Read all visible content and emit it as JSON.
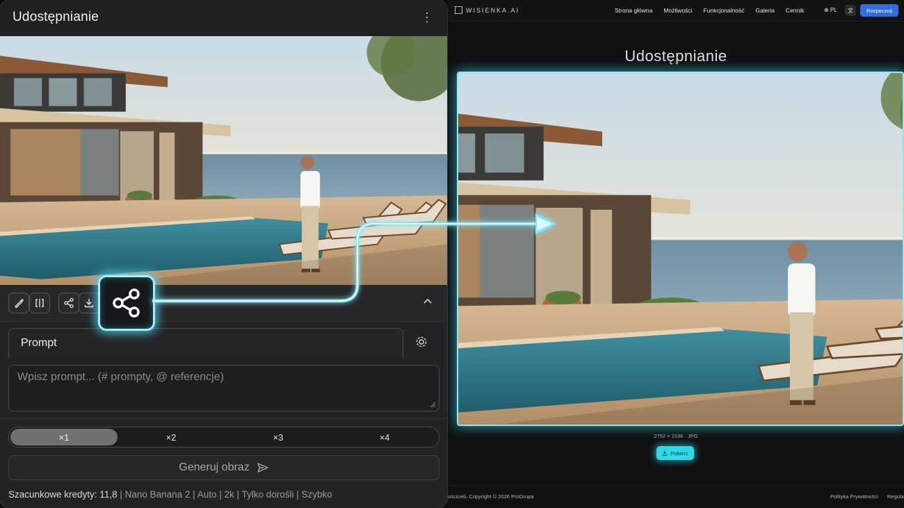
{
  "left": {
    "title": "Udostępnianie",
    "menu_icon": "kebab-vertical-icon",
    "toolbar_icons": [
      "brush-icon",
      "compare-icon",
      "share-icon",
      "download-icon",
      "chevron-up-icon"
    ],
    "highlight_icon": "share-icon",
    "prompt_tab": "Prompt",
    "prompt_placeholder": "Wpisz prompt... (# prompty, @ referencje)",
    "multipliers": [
      "×1",
      "×2",
      "×3",
      "×4"
    ],
    "selected_multiplier": "×1",
    "generate_label": "Generuj obraz",
    "credits": {
      "label": "Szacunkowe kredyty: 11,8",
      "details": " | Nano Banana 2 | Auto | 2k | Tylko dorośli | Szybko"
    }
  },
  "right": {
    "logo": "WISIENKA.AI",
    "nav": [
      "Strona główna",
      "Możliwości",
      "Funkcjonalność",
      "Galeria",
      "Cennik"
    ],
    "language": "PL",
    "start_button": "Rozpocznij",
    "title": "Udostępnianie",
    "image_meta": "2752 × 1536  ·  JPG",
    "download_label": "Pobierz",
    "copyright": "ościcieli. Copyright © 2026 ProGrupa",
    "footer_links": [
      "Polityka Prywatności",
      "Regula"
    ]
  },
  "colors": {
    "glow": "#7fe8ff",
    "accent_button": "#31d7e6",
    "start_button": "#2f6fe0"
  }
}
